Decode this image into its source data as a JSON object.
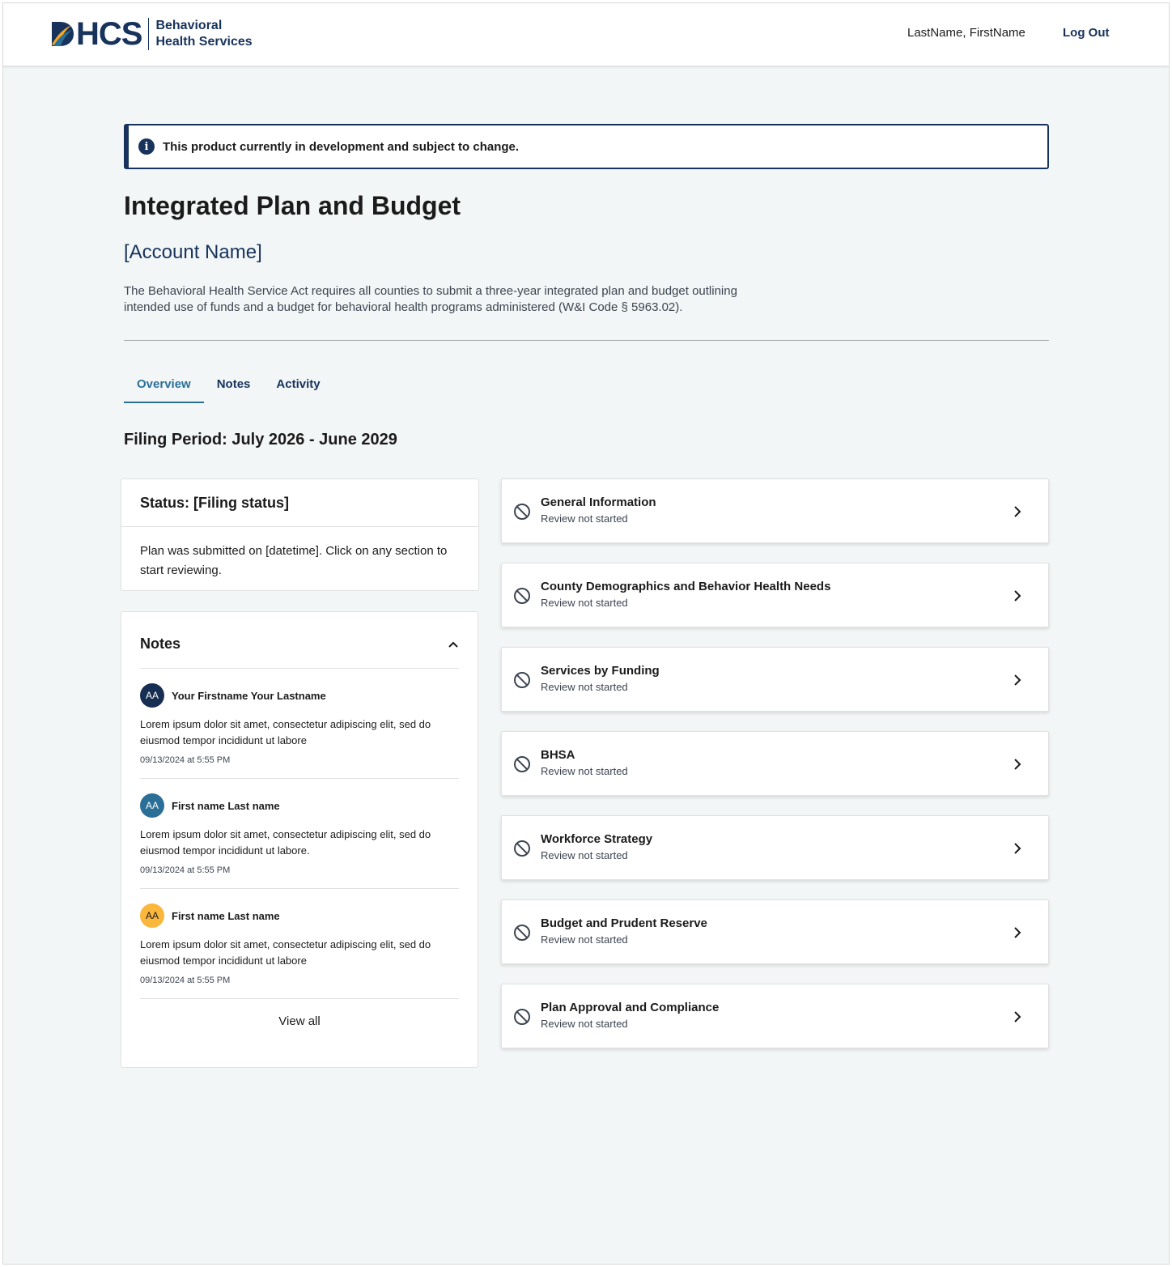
{
  "header": {
    "logo_main": "HCS",
    "logo_sub_line1": "Behavioral",
    "logo_sub_line2": "Health Services",
    "user_name": "LastName, FirstName",
    "logout_label": "Log Out"
  },
  "alert": {
    "icon": "info-icon",
    "text": "This product currently in development and subject to change."
  },
  "page": {
    "title": "Integrated Plan and Budget",
    "account_name": "[Account Name]",
    "description": "The Behavioral Health Service Act requires all counties to submit a three-year integrated plan and budget outlining intended use of funds and a budget for behavioral health programs administered (W&I Code § 5963.02)."
  },
  "tabs": [
    {
      "label": "Overview",
      "active": true
    },
    {
      "label": "Notes",
      "active": false
    },
    {
      "label": "Activity",
      "active": false
    }
  ],
  "filing_period": "Filing Period: July 2026 - June 2029",
  "status": {
    "heading": "Status: [Filing status]",
    "body": "Plan was submitted on [datetime]. Click on any section to start reviewing."
  },
  "notes": {
    "heading": "Notes",
    "items": [
      {
        "initials": "AA",
        "avatar_color": "#162e51",
        "author": "Your Firstname Your Lastname",
        "text": "Lorem ipsum dolor sit amet, consectetur adipiscing elit, sed do eiusmod tempor incididunt ut labore",
        "time": "09/13/2024 at 5:55 PM"
      },
      {
        "initials": "AA",
        "avatar_color": "#2a6f97",
        "author": "First name Last name",
        "text": "Lorem ipsum dolor sit amet, consectetur adipiscing elit, sed do eiusmod tempor incididunt ut labore.",
        "time": "09/13/2024 at 5:55 PM"
      },
      {
        "initials": "AA",
        "avatar_color": "#fbb63c",
        "author": "First name Last name",
        "text": "Lorem ipsum dolor sit amet, consectetur adipiscing elit, sed do eiusmod tempor incididunt ut labore",
        "time": "09/13/2024 at 5:55 PM"
      }
    ],
    "view_all_label": "View all"
  },
  "sections": [
    {
      "title": "General Information",
      "status": "Review not started"
    },
    {
      "title": "County Demographics and Behavior Health Needs",
      "status": "Review not started"
    },
    {
      "title": "Services by Funding",
      "status": "Review not started"
    },
    {
      "title": "BHSA",
      "status": "Review not started"
    },
    {
      "title": "Workforce Strategy",
      "status": "Review not started"
    },
    {
      "title": "Budget and Prudent Reserve",
      "status": "Review not started"
    },
    {
      "title": "Plan Approval and Compliance",
      "status": "Review not started"
    }
  ],
  "colors": {
    "brand_navy": "#17335c",
    "accent_teal": "#2a6f97",
    "page_bg": "#f3f6f7"
  }
}
